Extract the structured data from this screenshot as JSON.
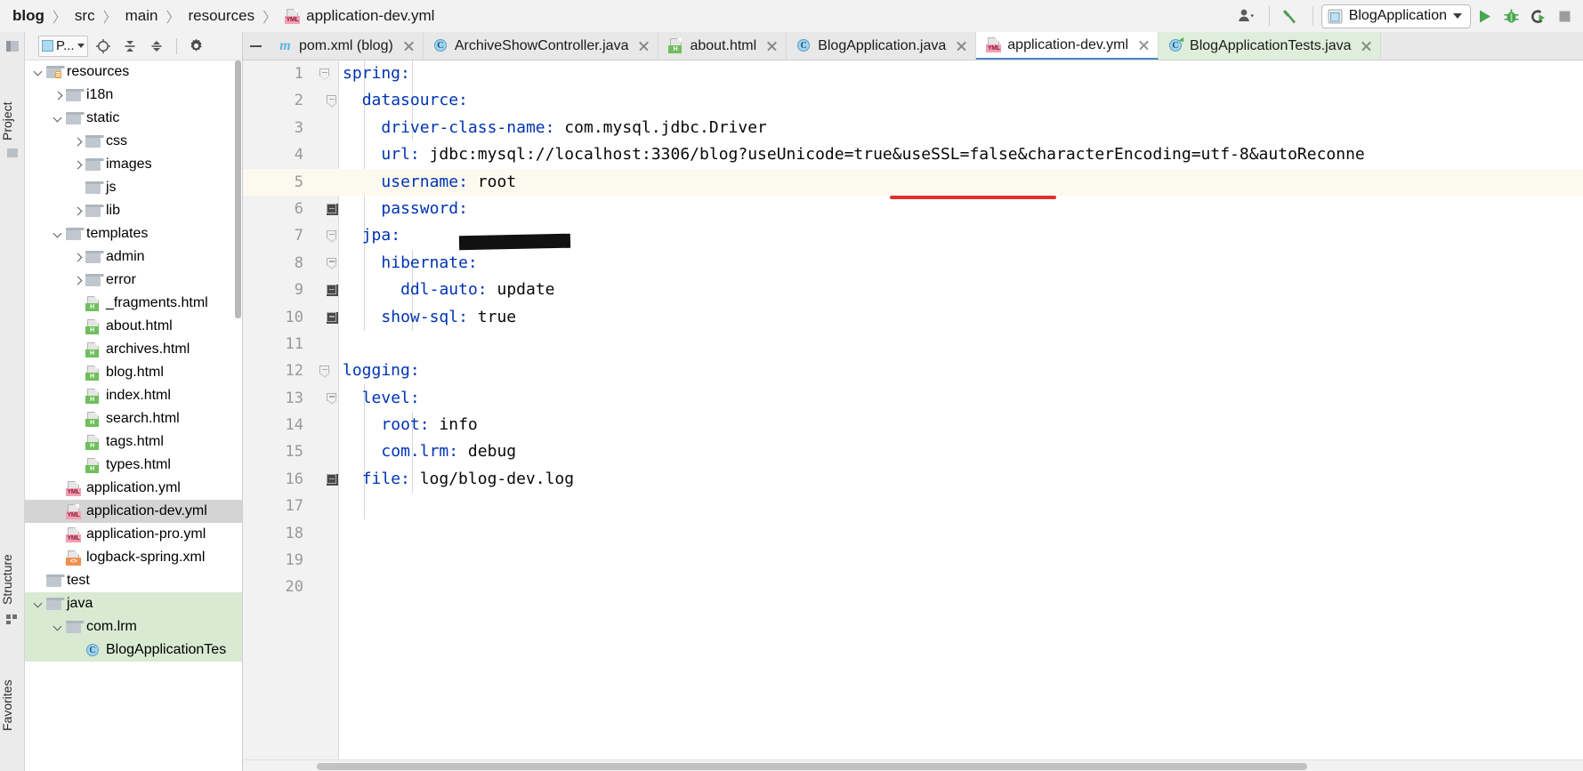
{
  "breadcrumb": {
    "items": [
      {
        "label": "blog",
        "bold": true
      },
      {
        "label": "src",
        "bold": false
      },
      {
        "label": "main",
        "bold": false
      },
      {
        "label": "resources",
        "bold": false
      }
    ],
    "separator": "〉",
    "file": {
      "label": "application-dev.yml",
      "icon": "yml-file-icon"
    }
  },
  "toolbar": {
    "user_icon": "user-account-icon",
    "user_caret": "▾",
    "hammer_icon": "build-hammer-icon",
    "run_config": {
      "label": "BlogApplication",
      "icon": "run-config-icon"
    },
    "run_icon": "run-icon",
    "debug_icon": "debug-icon",
    "run_coverage_icon": "run-with-coverage-icon",
    "stop_icon": "stop-icon"
  },
  "tool_strips": {
    "project_label": "Project",
    "structure_label": "Structure",
    "favorites_label": "Favorites"
  },
  "project_panel": {
    "toolbar": {
      "selector_label": "P...",
      "selector_caret": "▾",
      "locate_icon": "locate-file-icon",
      "expand_all_icon": "expand-all-icon",
      "collapse_all_icon": "collapse-all-icon",
      "settings_icon": "gear-icon"
    },
    "tree": [
      {
        "label": "resources",
        "icon": "resources-folder-icon",
        "twisty": "down",
        "indent": 0,
        "state": "normal"
      },
      {
        "label": "i18n",
        "icon": "folder-icon",
        "twisty": "right",
        "indent": 1,
        "state": "normal"
      },
      {
        "label": "static",
        "icon": "folder-icon",
        "twisty": "down",
        "indent": 1,
        "state": "normal"
      },
      {
        "label": "css",
        "icon": "folder-icon",
        "twisty": "right",
        "indent": 2,
        "state": "normal"
      },
      {
        "label": "images",
        "icon": "folder-icon",
        "twisty": "right",
        "indent": 2,
        "state": "normal"
      },
      {
        "label": "js",
        "icon": "folder-icon",
        "twisty": "none",
        "indent": 2,
        "state": "normal"
      },
      {
        "label": "lib",
        "icon": "folder-icon",
        "twisty": "right",
        "indent": 2,
        "state": "normal"
      },
      {
        "label": "templates",
        "icon": "folder-icon",
        "twisty": "down",
        "indent": 1,
        "state": "normal"
      },
      {
        "label": "admin",
        "icon": "folder-icon",
        "twisty": "right",
        "indent": 2,
        "state": "normal"
      },
      {
        "label": "error",
        "icon": "folder-icon",
        "twisty": "right",
        "indent": 2,
        "state": "normal"
      },
      {
        "label": "_fragments.html",
        "icon": "html-file-icon",
        "twisty": "none",
        "indent": 2,
        "state": "normal"
      },
      {
        "label": "about.html",
        "icon": "html-file-icon",
        "twisty": "none",
        "indent": 2,
        "state": "normal"
      },
      {
        "label": "archives.html",
        "icon": "html-file-icon",
        "twisty": "none",
        "indent": 2,
        "state": "normal"
      },
      {
        "label": "blog.html",
        "icon": "html-file-icon",
        "twisty": "none",
        "indent": 2,
        "state": "normal"
      },
      {
        "label": "index.html",
        "icon": "html-file-icon",
        "twisty": "none",
        "indent": 2,
        "state": "normal"
      },
      {
        "label": "search.html",
        "icon": "html-file-icon",
        "twisty": "none",
        "indent": 2,
        "state": "normal"
      },
      {
        "label": "tags.html",
        "icon": "html-file-icon",
        "twisty": "none",
        "indent": 2,
        "state": "normal"
      },
      {
        "label": "types.html",
        "icon": "html-file-icon",
        "twisty": "none",
        "indent": 2,
        "state": "normal"
      },
      {
        "label": "application.yml",
        "icon": "yml-file-icon",
        "twisty": "none",
        "indent": 1,
        "state": "normal"
      },
      {
        "label": "application-dev.yml",
        "icon": "yml-file-icon",
        "twisty": "none",
        "indent": 1,
        "state": "selected"
      },
      {
        "label": "application-pro.yml",
        "icon": "yml-file-icon",
        "twisty": "none",
        "indent": 1,
        "state": "normal"
      },
      {
        "label": "logback-spring.xml",
        "icon": "xml-file-icon",
        "twisty": "none",
        "indent": 1,
        "state": "normal"
      },
      {
        "label": "test",
        "icon": "folder-icon",
        "twisty": "none",
        "indent": 0,
        "state": "normal"
      },
      {
        "label": "java",
        "icon": "folder-icon",
        "twisty": "down",
        "indent": 0,
        "state": "highlighted"
      },
      {
        "label": "com.lrm",
        "icon": "folder-icon",
        "twisty": "down",
        "indent": 1,
        "state": "highlighted"
      },
      {
        "label": "BlogApplicationTes",
        "icon": "java-class-icon",
        "twisty": "none",
        "indent": 2,
        "state": "highlighted"
      }
    ]
  },
  "editor": {
    "tabs": [
      {
        "label": "pom.xml (blog)",
        "icon": "maven-icon",
        "state": "normal",
        "closable": true
      },
      {
        "label": "ArchiveShowController.java",
        "icon": "java-class-icon",
        "state": "normal",
        "closable": true
      },
      {
        "label": "about.html",
        "icon": "html-file-icon",
        "state": "normal",
        "closable": true
      },
      {
        "label": "BlogApplication.java",
        "icon": "java-class-icon",
        "state": "normal",
        "closable": true
      },
      {
        "label": "application-dev.yml",
        "icon": "yml-file-icon",
        "state": "active",
        "closable": true
      },
      {
        "label": "BlogApplicationTests.java",
        "icon": "java-test-class-icon",
        "state": "green",
        "closable": true
      }
    ],
    "hide_tabs_icon": "collapse-editor-icon",
    "lines": [
      {
        "num": "1",
        "indent": 0,
        "key": "spring",
        "value": "",
        "fold": "minus-top",
        "caret": false
      },
      {
        "num": "2",
        "indent": 2,
        "key": "datasource",
        "value": "",
        "fold": "minus-top",
        "caret": false
      },
      {
        "num": "3",
        "indent": 4,
        "key": "driver-class-name",
        "value": " com.mysql.jdbc.Driver",
        "fold": "none",
        "caret": false
      },
      {
        "num": "4",
        "indent": 4,
        "key": "url",
        "value": " jdbc:mysql://localhost:3306/blog?useUnicode=true&useSSL=false&characterEncoding=utf-8&autoReconne",
        "fold": "none",
        "caret": false
      },
      {
        "num": "5",
        "indent": 4,
        "key": "username",
        "value": " root",
        "fold": "none",
        "caret": true
      },
      {
        "num": "6",
        "indent": 4,
        "key": "password",
        "value": "",
        "fold": "minus-box",
        "caret": false
      },
      {
        "num": "7",
        "indent": 2,
        "key": "jpa",
        "value": "",
        "fold": "minus-top",
        "caret": false
      },
      {
        "num": "8",
        "indent": 4,
        "key": "hibernate",
        "value": "",
        "fold": "minus-top",
        "caret": false
      },
      {
        "num": "9",
        "indent": 6,
        "key": "ddl-auto",
        "value": " update",
        "fold": "minus-box",
        "caret": false
      },
      {
        "num": "10",
        "indent": 4,
        "key": "show-sql",
        "value": " true",
        "fold": "minus-box",
        "caret": false
      },
      {
        "num": "11",
        "indent": 0,
        "key": "",
        "value": "",
        "fold": "none",
        "caret": false
      },
      {
        "num": "12",
        "indent": 0,
        "key": "logging",
        "value": "",
        "fold": "minus-top",
        "caret": false
      },
      {
        "num": "13",
        "indent": 2,
        "key": "level",
        "value": "",
        "fold": "minus-top",
        "caret": false
      },
      {
        "num": "14",
        "indent": 4,
        "key": "root",
        "value": " info",
        "fold": "none",
        "caret": false
      },
      {
        "num": "15",
        "indent": 4,
        "key": "com.lrm",
        "value": " debug",
        "fold": "none",
        "caret": false
      },
      {
        "num": "16",
        "indent": 2,
        "key": "file",
        "value": " log/blog-dev.log",
        "fold": "minus-box",
        "caret": false
      },
      {
        "num": "17",
        "indent": 0,
        "key": "",
        "value": "",
        "fold": "none",
        "caret": false
      },
      {
        "num": "18",
        "indent": 0,
        "key": "",
        "value": "",
        "fold": "none",
        "caret": false
      },
      {
        "num": "19",
        "indent": 0,
        "key": "",
        "value": "",
        "fold": "none",
        "caret": false
      },
      {
        "num": "20",
        "indent": 0,
        "key": "",
        "value": "",
        "fold": "none",
        "caret": false
      }
    ],
    "annotations": {
      "red_underline": "useSSL=false-underline",
      "password_redaction": "password-value-redaction-bar"
    }
  },
  "colors": {
    "yaml_key": "#0033b3",
    "yaml_value": "#080808",
    "annotation_red": "#e03030",
    "selection_gray": "#d4d4d4",
    "highlight_green": "#d9ead3",
    "caret_line": "#fcfaef",
    "accent_blue": "#4f87c4"
  }
}
